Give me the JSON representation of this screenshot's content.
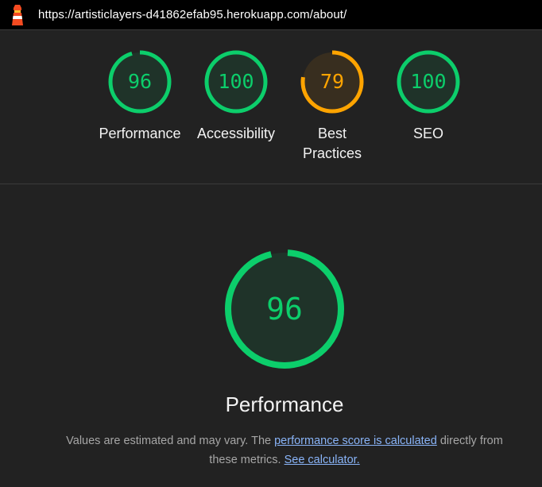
{
  "header": {
    "url": "https://artisticlayers-d41862efab95.herokuapp.com/about/",
    "logo_icon": "lighthouse-icon"
  },
  "gauges": [
    {
      "id": "performance",
      "score": "96",
      "label": "Performance",
      "status": "pass",
      "fraction": 0.96
    },
    {
      "id": "accessibility",
      "score": "100",
      "label": "Accessibility",
      "status": "pass",
      "fraction": 1.0
    },
    {
      "id": "best-practices",
      "score": "79",
      "label": "Best Practices",
      "status": "average",
      "fraction": 0.79
    },
    {
      "id": "seo",
      "score": "100",
      "label": "SEO",
      "status": "pass",
      "fraction": 1.0
    }
  ],
  "category": {
    "score": "96",
    "fraction": 0.96,
    "title": "Performance",
    "description_prefix": "Values are estimated and may vary. The ",
    "link1": "performance score is calculated",
    "description_middle": " directly from these metrics. ",
    "link2": "See calculator."
  },
  "colors": {
    "pass": "#0cce6b",
    "pass_fill": "#1f3329",
    "average": "#ffa400",
    "average_fill": "#382e1f",
    "background": "#222222"
  }
}
